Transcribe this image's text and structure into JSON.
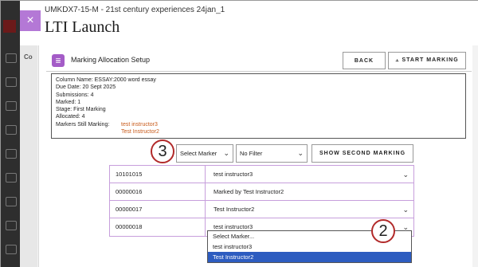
{
  "header": {
    "course": "UMKDX7-15-M - 21st century experiences 24jan_1",
    "title": "LTI Launch",
    "close_glyph": "×"
  },
  "side": {
    "tab_text": "Co"
  },
  "setup": {
    "icon_glyph": "≣",
    "label": "Marking Allocation Setup",
    "back_label": "BACK",
    "start_label": "⫠ START MARKING"
  },
  "info": {
    "column": "Column Name:   ESSAY:2000 word essay",
    "due": "Due Date:   20 Sept 2025",
    "submissions": "Submissions:   4",
    "marked": "Marked:   1",
    "stage": "Stage:   First Marking",
    "allocated": "Allocated:   4",
    "markers_label": "Markers Still Marking:",
    "markers": [
      "test instructor3",
      "Test Instructor2"
    ]
  },
  "controls": {
    "marker_select": "Select Marker",
    "filter_select": "No Filter",
    "show_second": "SHOW SECOND MARKING"
  },
  "callouts": {
    "c3": "3",
    "c2": "2"
  },
  "rows": [
    {
      "id": "10101015",
      "marker": "test instructor3",
      "has_select": true
    },
    {
      "id": "00000016",
      "marker": "Marked by Test Instructor2",
      "has_select": false
    },
    {
      "id": "00000017",
      "marker": "Test Instructor2",
      "has_select": true
    },
    {
      "id": "00000018",
      "marker": "test instructor3",
      "has_select": true
    }
  ],
  "dropdown": {
    "options": [
      "Select Marker...",
      "test instructor3",
      "Test Instructor2"
    ],
    "highlighted_index": 2
  },
  "colors": {
    "accent": "#a45cc7",
    "marker_text": "#c85a1a",
    "highlight": "#2d5cc0",
    "callout": "#b22a2a"
  }
}
